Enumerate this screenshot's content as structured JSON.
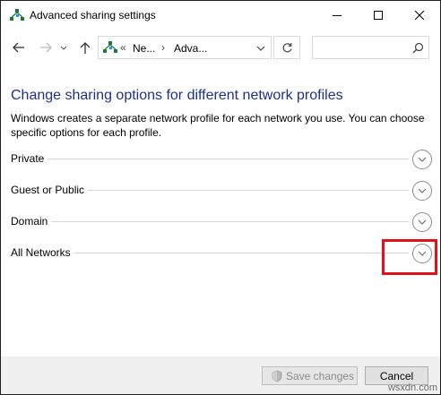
{
  "window": {
    "title": "Advanced sharing settings",
    "icon": "network-sharing-icon"
  },
  "navigation": {
    "crumb_prefix": "«",
    "breadcrumbs": [
      "Ne...",
      "Adva..."
    ],
    "crumb_separator": "›",
    "search_placeholder": ""
  },
  "main": {
    "heading": "Change sharing options for different network profiles",
    "description": "Windows creates a separate network profile for each network you use. You can choose specific options for each profile.",
    "profiles": [
      {
        "label": "Private"
      },
      {
        "label": "Guest or Public"
      },
      {
        "label": "Domain"
      },
      {
        "label": "All Networks"
      }
    ]
  },
  "footer": {
    "save_label": "Save changes",
    "cancel_label": "Cancel"
  },
  "watermark": "wsxdn.com",
  "colors": {
    "heading": "#1e3287",
    "highlight": "#e0131b",
    "footer_bg": "#f0f0f0"
  }
}
